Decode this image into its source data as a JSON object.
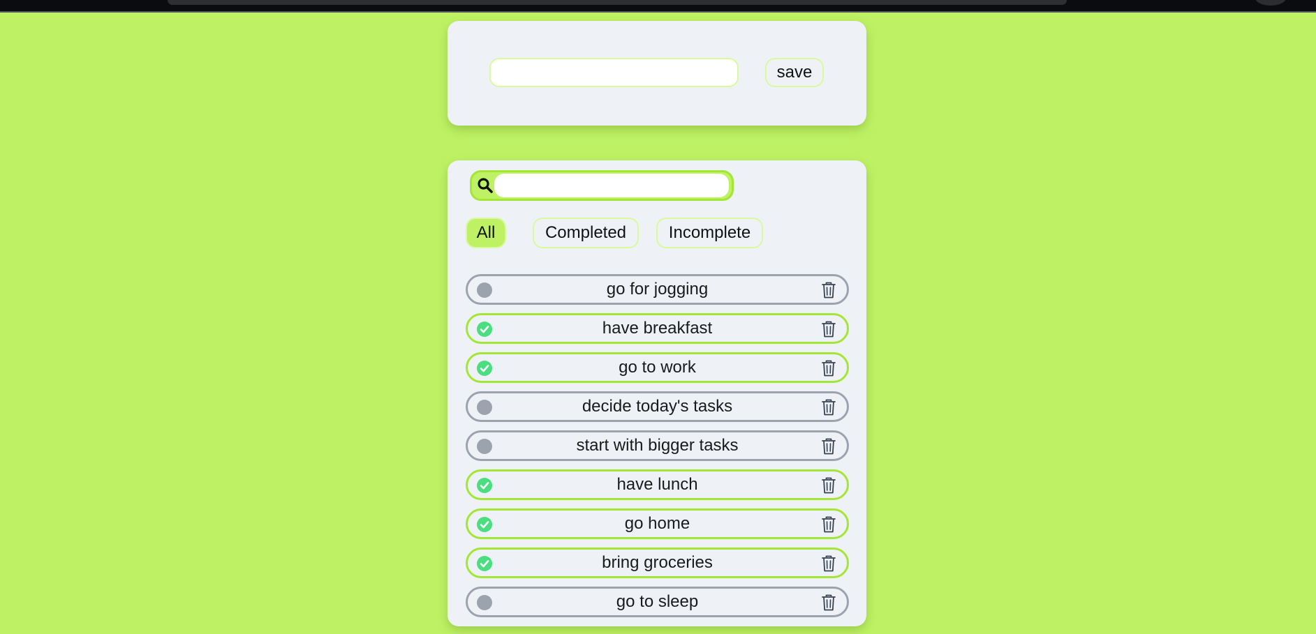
{
  "add_task": {
    "input_value": "",
    "save_label": "save"
  },
  "search": {
    "value": ""
  },
  "filters": [
    {
      "label": "All",
      "active": true
    },
    {
      "label": "Completed",
      "active": false
    },
    {
      "label": "Incomplete",
      "active": false
    }
  ],
  "tasks": [
    {
      "label": "go for jogging",
      "completed": false
    },
    {
      "label": "have breakfast",
      "completed": true
    },
    {
      "label": "go to work",
      "completed": true
    },
    {
      "label": "decide today's tasks",
      "completed": false
    },
    {
      "label": "start with bigger tasks",
      "completed": false
    },
    {
      "label": "have lunch",
      "completed": true
    },
    {
      "label": "go home",
      "completed": true
    },
    {
      "label": "bring groceries",
      "completed": true
    },
    {
      "label": "go to sleep",
      "completed": false
    }
  ],
  "colors": {
    "background": "#bef264",
    "card": "#eef2f7",
    "accent_border": "#a3e635",
    "completed_check": "#4ade80",
    "incomplete_dot": "#9ca3af"
  }
}
